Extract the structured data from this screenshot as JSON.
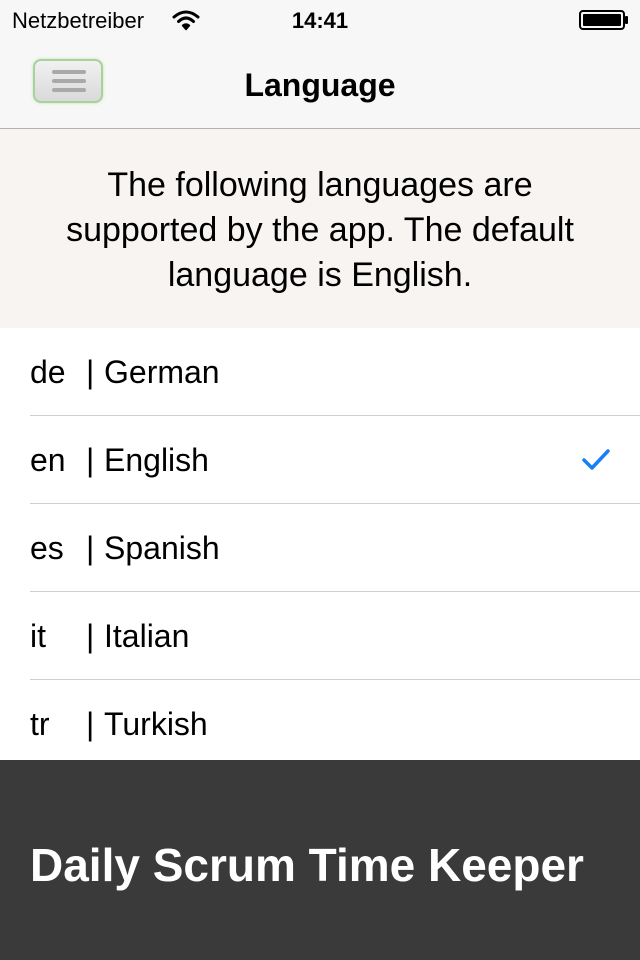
{
  "status_bar": {
    "carrier": "Netzbetreiber",
    "time": "14:41",
    "wifi_icon": "wifi-icon",
    "battery_icon": "battery-icon"
  },
  "nav": {
    "title": "Language",
    "menu_icon": "menu-icon"
  },
  "info": {
    "text": "The following languages are supported by the app. The default language is English."
  },
  "languages": [
    {
      "code": "de",
      "separator": "|",
      "name": "German",
      "selected": false
    },
    {
      "code": "en",
      "separator": "|",
      "name": "English",
      "selected": true
    },
    {
      "code": "es",
      "separator": "|",
      "name": "Spanish",
      "selected": false
    },
    {
      "code": "it",
      "separator": "|",
      "name": "Italian",
      "selected": false
    },
    {
      "code": "tr",
      "separator": "|",
      "name": "Turkish",
      "selected": false
    }
  ],
  "footer": {
    "title": "Daily Scrum Time Keeper"
  },
  "colors": {
    "accent": "#1a7ff5",
    "footer_bg": "#3a3a3a",
    "info_bg": "#f8f4f2",
    "menu_border": "#a7d29a"
  }
}
